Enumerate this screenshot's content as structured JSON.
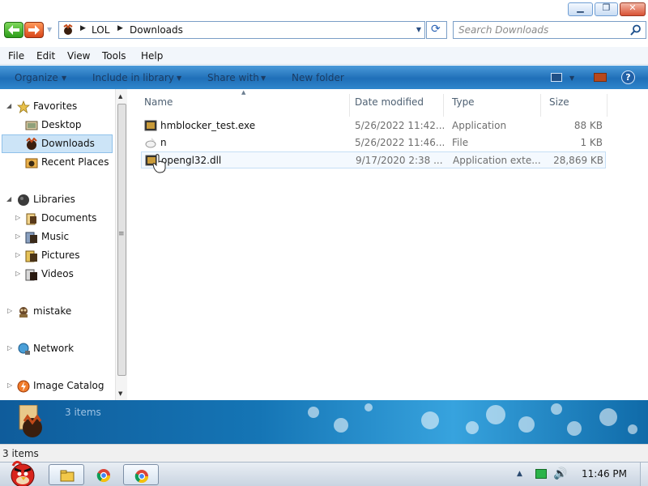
{
  "window": {
    "minimize_glyph": "▁",
    "maximize_glyph": "❐",
    "close_glyph": "✕"
  },
  "address": {
    "crumbs": [
      "LOL",
      "Downloads"
    ],
    "refresh_glyph": "⟳"
  },
  "search": {
    "placeholder": "Search Downloads"
  },
  "menu": {
    "items": [
      "File",
      "Edit",
      "View",
      "Tools",
      "Help"
    ]
  },
  "toolbar": {
    "organize": "Organize",
    "include_in_library": "Include in library",
    "share_with": "Share with",
    "new_folder": "New folder",
    "dropdown_glyph": "▼",
    "help_glyph": "?"
  },
  "nav": {
    "favorites": "Favorites",
    "desktop": "Desktop",
    "downloads": "Downloads",
    "recent_places": "Recent Places",
    "libraries": "Libraries",
    "documents": "Documents",
    "music": "Music",
    "pictures": "Pictures",
    "videos": "Videos",
    "mistake": "mistake",
    "network": "Network",
    "image_catalog": "Image Catalog",
    "expanded_glyph": "◢",
    "collapsed_glyph": "▷"
  },
  "columns": {
    "name": "Name",
    "date_modified": "Date modified",
    "type": "Type",
    "size": "Size",
    "sort_glyph": "▲"
  },
  "files": [
    {
      "name": "hmblocker_test.exe",
      "date": "5/26/2022 11:42...",
      "type": "Application",
      "size": "88 KB",
      "icon": "application-icon"
    },
    {
      "name": "n",
      "date": "5/26/2022 11:46...",
      "type": "File",
      "size": "1 KB",
      "icon": "blank-file-icon"
    },
    {
      "name": "opengl32.dll",
      "date": "9/17/2020 2:38 ...",
      "type": "Application exte...",
      "size": "28,869 KB",
      "icon": "dll-file-icon"
    }
  ],
  "details_pane": {
    "item_count": "3 items"
  },
  "status_bar": {
    "text": "3 items"
  },
  "taskbar": {
    "clock": "11:46 PM",
    "tray_arrow": "▲",
    "volume_glyph": "🔊"
  },
  "colors": {
    "command_bar": "#1f6fb8",
    "selection": "#cce4f7",
    "back_button": "#2d9d1a",
    "forward_button": "#d9461a"
  }
}
